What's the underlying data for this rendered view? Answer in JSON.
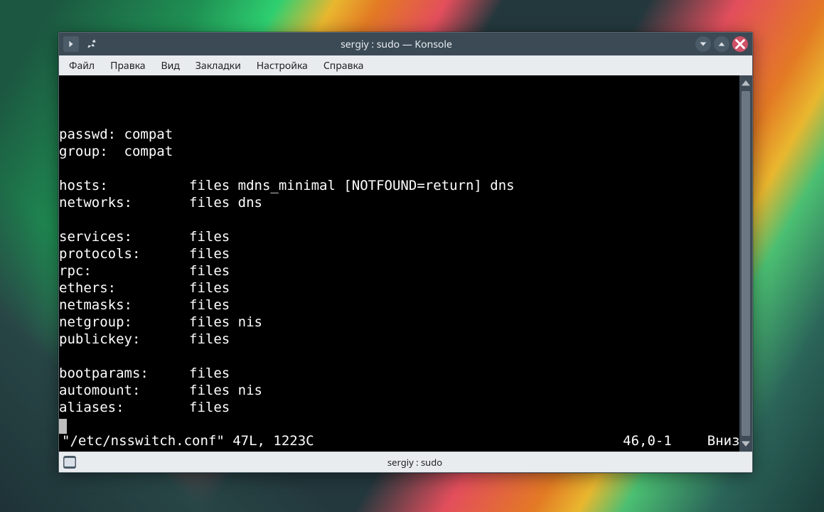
{
  "window": {
    "title": "sergiy : sudo — Konsole"
  },
  "titlebar": {
    "menu_icon": "menu"
  },
  "menubar": {
    "items": [
      {
        "label": "Файл"
      },
      {
        "label": "Правка"
      },
      {
        "label": "Вид"
      },
      {
        "label": "Закладки"
      },
      {
        "label": "Настройка"
      },
      {
        "label": "Справка"
      }
    ]
  },
  "terminal": {
    "lines": [
      "",
      "passwd: compat",
      "group:  compat",
      "",
      "hosts:          files mdns_minimal [NOTFOUND=return] dns",
      "networks:       files dns",
      "",
      "services:       files",
      "protocols:      files",
      "rpc:            files",
      "ethers:         files",
      "netmasks:       files",
      "netgroup:       files nis",
      "publickey:      files",
      "",
      "bootparams:     files",
      "automount:      files nis",
      "aliases:        files"
    ],
    "vi_status": {
      "filename": "\"/etc/nsswitch.conf\" 47L, 1223C",
      "position": "46,0-1",
      "location": "Внизу"
    }
  },
  "tabstrip": {
    "tab_label": "sergiy : sudo"
  }
}
